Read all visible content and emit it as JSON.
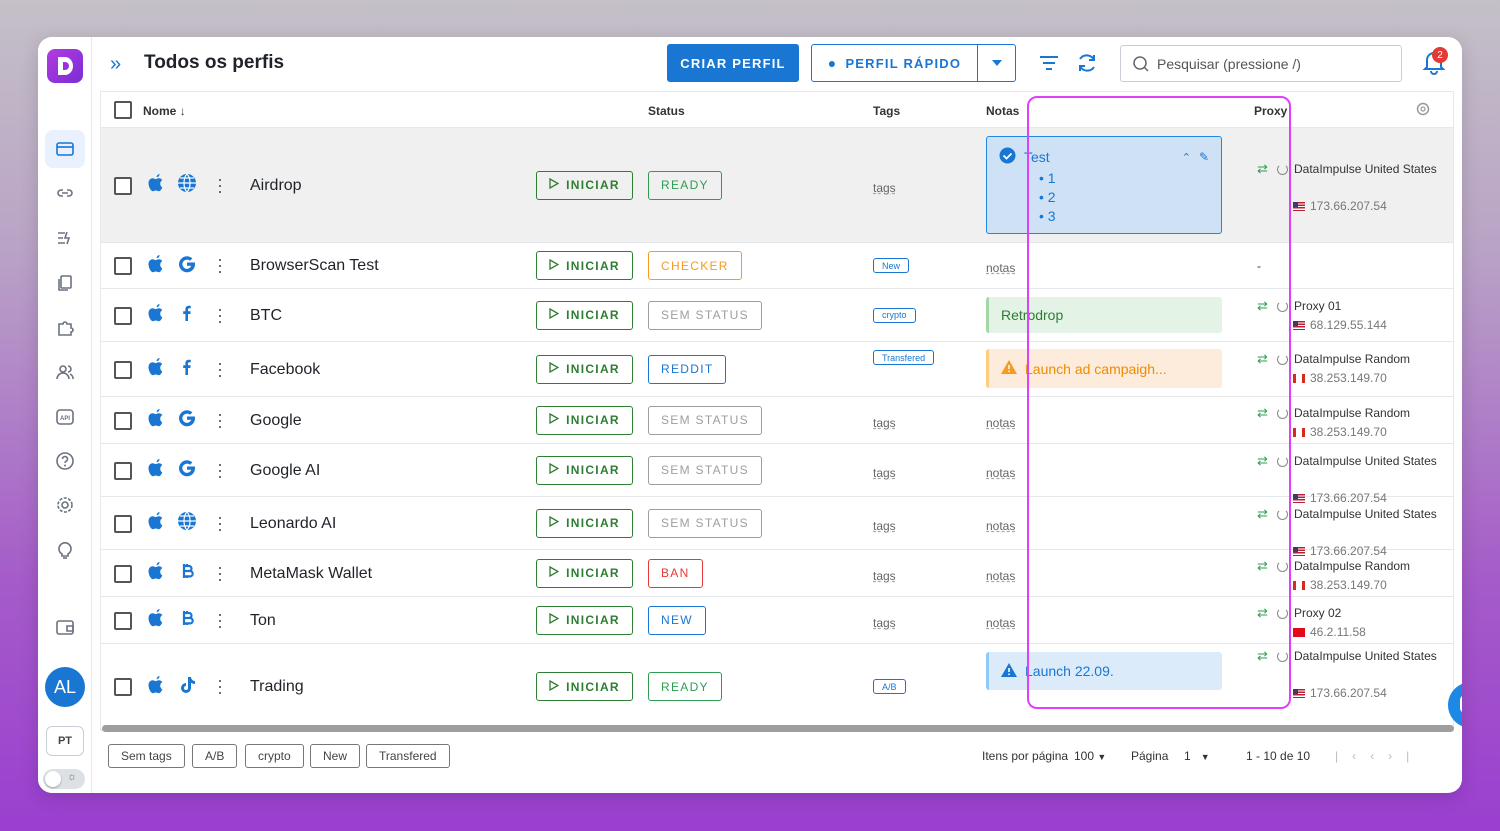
{
  "header": {
    "title": "Todos os perfis",
    "create_label": "CRIAR PERFIL",
    "quick_label": "PERFIL RÁPIDO",
    "search_placeholder": "Pesquisar (pressione /)",
    "notification_count": "2"
  },
  "sidebar": {
    "icons": [
      "browser-icon",
      "link-icon",
      "automation-icon",
      "copy-icon",
      "puzzle-icon",
      "users-icon",
      "api-icon",
      "help-icon",
      "settings-icon",
      "bulb-icon",
      "wallet-icon"
    ],
    "avatar": "AL",
    "lang": "PT"
  },
  "table": {
    "headers": {
      "name": "Nome",
      "status": "Status",
      "tags": "Tags",
      "notes": "Notas",
      "proxy": "Proxy"
    },
    "start_label": "INICIAR",
    "rows": [
      {
        "name": "Airdrop",
        "icon": "globe",
        "status": "READY",
        "tag": "tags",
        "note_type": "list",
        "note_title": "Test",
        "note_items": [
          "1",
          "2",
          "3"
        ],
        "proxy_name": "DataImpulse United States",
        "proxy_ip": "173.66.207.54",
        "flag": "us"
      },
      {
        "name": "BrowserScan Test",
        "icon": "google",
        "status": "CHECKER",
        "tag": "New",
        "note_type": "empty",
        "note": "notas",
        "proxy_name": "-",
        "proxy_ip": "",
        "flag": ""
      },
      {
        "name": "BTC",
        "icon": "facebook",
        "status": "SEM STATUS",
        "tag": "crypto",
        "note_type": "green",
        "note": "Retrodrop",
        "proxy_name": "Proxy 01",
        "proxy_ip": "68.129.55.144",
        "flag": "us"
      },
      {
        "name": "Facebook",
        "icon": "facebook",
        "status": "REDDIT",
        "tag": "Transfered",
        "note_type": "warning",
        "note": "Launch ad campaigh...",
        "proxy_name": "DataImpulse Random",
        "proxy_ip": "38.253.149.70",
        "flag": "ca"
      },
      {
        "name": "Google",
        "icon": "google",
        "status": "SEM STATUS",
        "tag": "tags",
        "note_type": "empty",
        "note": "notas",
        "proxy_name": "DataImpulse Random",
        "proxy_ip": "38.253.149.70",
        "flag": "ca"
      },
      {
        "name": "Google AI",
        "icon": "google",
        "status": "SEM STATUS",
        "tag": "tags",
        "note_type": "empty",
        "note": "notas",
        "proxy_name": "DataImpulse United States",
        "proxy_ip": "173.66.207.54",
        "flag": "us"
      },
      {
        "name": "Leonardo AI",
        "icon": "globe",
        "status": "SEM STATUS",
        "tag": "tags",
        "note_type": "empty",
        "note": "notas",
        "proxy_name": "DataImpulse United States",
        "proxy_ip": "173.66.207.54",
        "flag": "us"
      },
      {
        "name": "MetaMask Wallet",
        "icon": "bitcoin",
        "status": "BAN",
        "tag": "tags",
        "note_type": "empty",
        "note": "notas",
        "proxy_name": "DataImpulse Random",
        "proxy_ip": "38.253.149.70",
        "flag": "ca"
      },
      {
        "name": "Ton",
        "icon": "bitcoin",
        "status": "NEW",
        "tag": "tags",
        "note_type": "empty",
        "note": "notas",
        "proxy_name": "Proxy 02",
        "proxy_ip": "46.2.11.58",
        "flag": "tr"
      },
      {
        "name": "Trading",
        "icon": "tiktok",
        "status": "READY",
        "tag": "A/B",
        "note_type": "info",
        "note": "Launch 22.09.",
        "proxy_name": "DataImpulse United States",
        "proxy_ip": "173.66.207.54",
        "flag": "us"
      }
    ]
  },
  "status_colors": {
    "READY": "#2e9d52",
    "CHECKER": "#f59b23",
    "SEM STATUS": "#9e9e9e",
    "REDDIT": "#1976d2",
    "BAN": "#e53935",
    "NEW": "#1976d2"
  },
  "footer": {
    "chips": [
      "Sem tags",
      "A/B",
      "crypto",
      "New",
      "Transfered"
    ],
    "per_page_label": "Itens por página",
    "per_page": "100",
    "page_label": "Página",
    "page": "1",
    "range": "1 - 10 de 10"
  }
}
